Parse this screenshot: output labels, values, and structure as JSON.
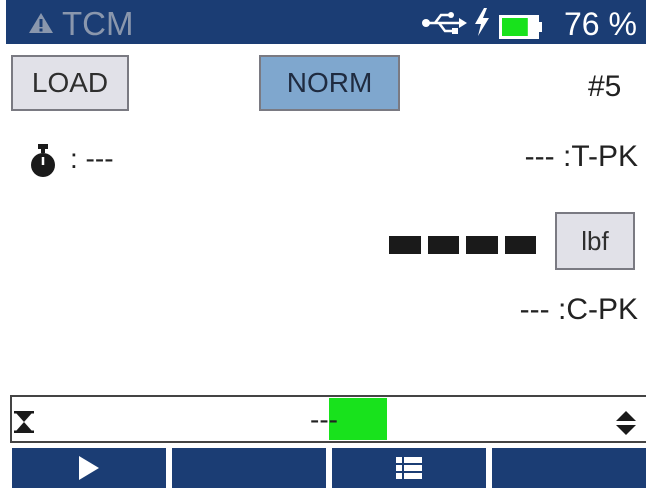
{
  "status_bar": {
    "app_title": "TCM",
    "battery_level": 0.76,
    "battery_text": "76 %",
    "icons": [
      "warning-icon",
      "usb-icon",
      "charging-bolt-icon",
      "battery-icon"
    ]
  },
  "buttons": {
    "load_label": "LOAD",
    "norm_label": "NORM",
    "unit_label": "lbf"
  },
  "channel": "#5",
  "timer": {
    "icon": "stopwatch-icon",
    "value": ": ---"
  },
  "readings": {
    "tension_peak": "--- :T-PK",
    "compression_peak": "--- :C-PK"
  },
  "progress": {
    "text": "---",
    "icons": [
      "hourglass-icon",
      "up-down-arrows-icon"
    ]
  },
  "softkeys": [
    {
      "icon": "play-icon"
    },
    {
      "icon": ""
    },
    {
      "icon": "list-icon"
    },
    {
      "icon": ""
    }
  ],
  "colors": {
    "bar_blue": "#1b3d74",
    "norm_button": "#7fa7ce",
    "progress_green": "#18e21c",
    "battery_green": "#18e21c"
  }
}
